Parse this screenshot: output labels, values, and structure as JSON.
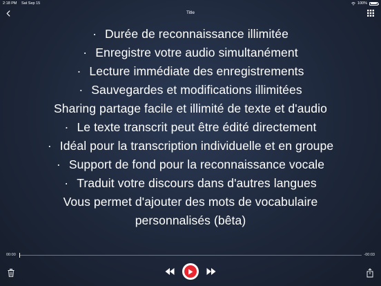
{
  "status_bar": {
    "time": "2:18 PM",
    "date": "Sat Sep 15",
    "battery_text": "100%",
    "battery_level": 1.0
  },
  "nav": {
    "title": "Title",
    "back_icon": "chevron-left-icon",
    "menu_icon": "grid-icon"
  },
  "content": {
    "bullet": "·",
    "lines": [
      {
        "text": "Durée de reconnaissance illimitée",
        "bulleted": true
      },
      {
        "text": "Enregistre votre audio simultanément",
        "bulleted": true
      },
      {
        "text": "Lecture immédiate des enregistrements",
        "bulleted": true
      },
      {
        "text": "Sauvegardes et modifications illimitées",
        "bulleted": true
      },
      {
        "text": "Sharing partage facile et illimité de texte et d'audio",
        "bulleted": false
      },
      {
        "text": "Le texte transcrit peut être édité directement",
        "bulleted": true
      },
      {
        "text": "Idéal pour la transcription individuelle et en groupe",
        "bulleted": true
      },
      {
        "text": "Support de fond pour la reconnaissance vocale",
        "bulleted": true
      },
      {
        "text": "Traduit votre discours dans d'autres langues",
        "bulleted": true
      },
      {
        "text": "Vous permet d'ajouter des mots de vocabulaire",
        "bulleted": false
      },
      {
        "text": "personnalisés (bêta)",
        "bulleted": false
      }
    ]
  },
  "player": {
    "elapsed": "00:00",
    "remaining": "-00:03",
    "progress": 0.0
  },
  "colors": {
    "accent": "#e8262f",
    "background": "#1e283b",
    "text": "#ffffff"
  },
  "icons": {
    "trash": "trash-icon",
    "rewind": "rewind-icon",
    "play": "play-icon",
    "forward": "fast-forward-icon",
    "share": "share-icon"
  }
}
